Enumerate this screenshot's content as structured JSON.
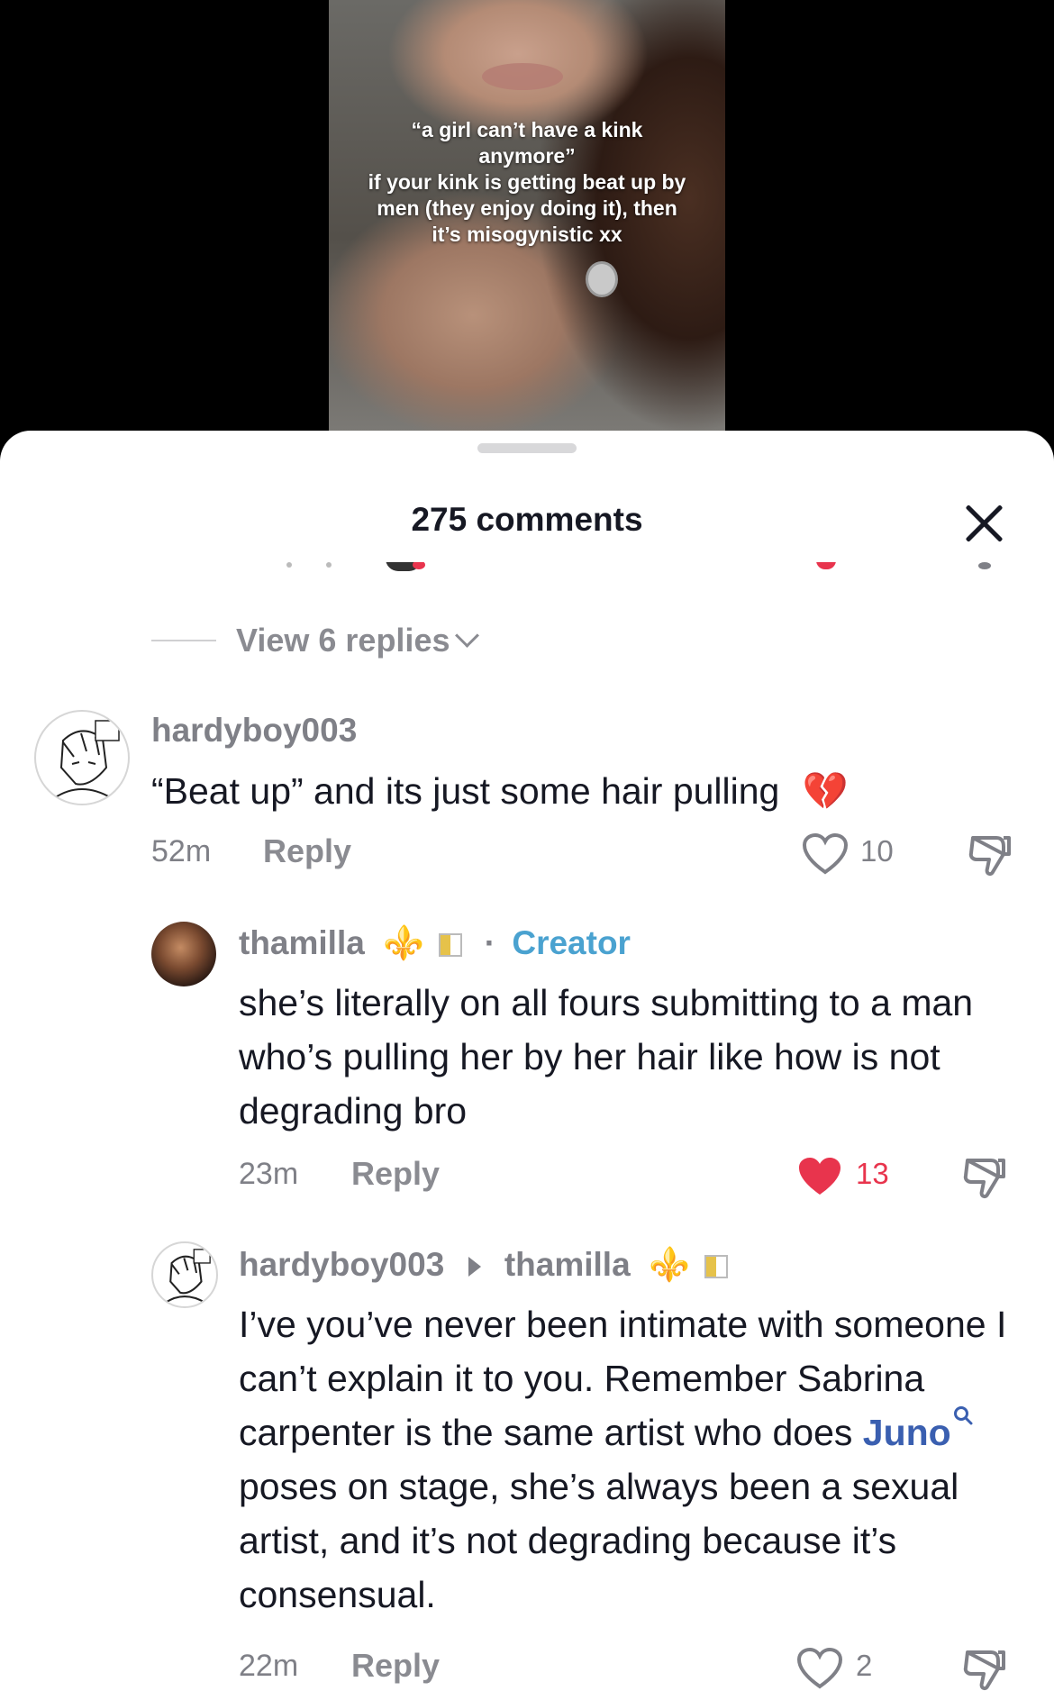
{
  "video": {
    "caption_lines": [
      "“a girl can’t have a kink",
      "anymore”",
      "if your kink is getting beat up by",
      "men (they enjoy doing it), then",
      "it’s misogynistic xx"
    ]
  },
  "sheet": {
    "title": "275 comments",
    "close_icon": "close-icon"
  },
  "view_replies": {
    "label": "View 6 replies",
    "icon": "chevron-down-icon"
  },
  "comments": [
    {
      "username": "hardyboy003",
      "text": "“Beat up” and its just some hair pulling",
      "emoji": "💔",
      "time": "52m",
      "reply_label": "Reply",
      "likes": "10",
      "liked": false
    },
    {
      "username": "thamilla",
      "badge_emoji": "⚜️",
      "separator": "·",
      "creator_label": "Creator",
      "text": "she’s literally on all fours submitting to a man who’s pulling her by her hair like how is not degrading bro",
      "time": "23m",
      "reply_label": "Reply",
      "likes": "13",
      "liked": true,
      "like_color": "#e8344d"
    },
    {
      "username": "hardyboy003",
      "reply_to": "thamilla",
      "badge_emoji": "⚜️",
      "text_before": "I’ve you’ve never been intimate with someone I can’t explain it to you. Remember Sabrina carpenter is the same artist who does ",
      "search_term": "Juno",
      "text_after": " poses on stage, she’s always been a sexual artist, and it’s not degrading because it’s consensual.",
      "time": "22m",
      "reply_label": "Reply",
      "likes": "2",
      "liked": false
    }
  ]
}
